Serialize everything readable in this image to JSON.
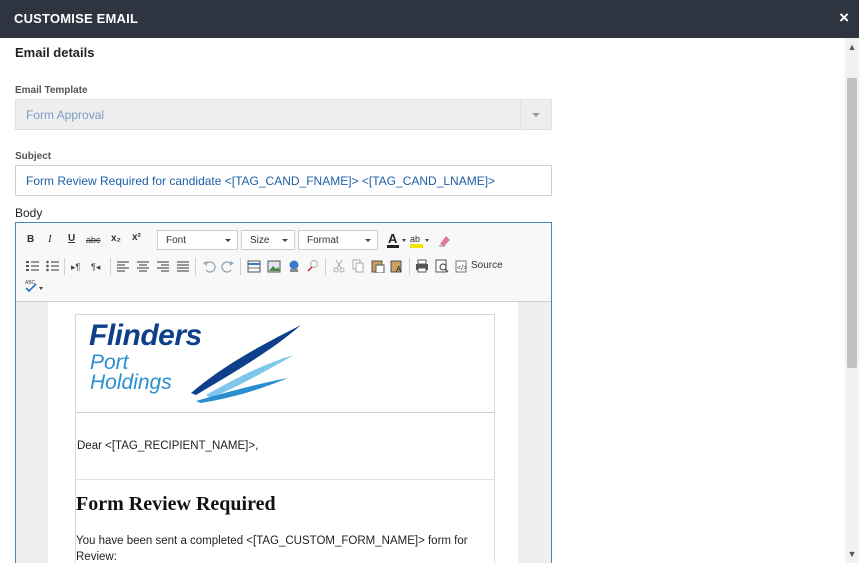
{
  "dialog": {
    "title": "CUSTOMISE EMAIL",
    "close_glyph": "×"
  },
  "form": {
    "section_title": "Email details",
    "template_label": "Email Template",
    "template_value": "Form Approval",
    "subject_label": "Subject",
    "subject_value": "Form Review Required for candidate <[TAG_CAND_FNAME]> <[TAG_CAND_LNAME]>",
    "body_label": "Body"
  },
  "toolbar": {
    "bold": "B",
    "italic": "I",
    "underline": "U",
    "strike": "abc",
    "subscript": "x₂",
    "superscript": "x²",
    "font_dropdown": "Font",
    "size_dropdown": "Size",
    "format_dropdown": "Format",
    "source_label": "Source",
    "icons": [
      "numbered-list-icon",
      "bullet-list-icon",
      "ltr-icon",
      "rtl-icon",
      "align-left-icon",
      "align-center-icon",
      "align-right-icon",
      "justify-icon",
      "undo-icon",
      "redo-icon",
      "table-icon",
      "image-icon",
      "link-icon",
      "unlink-icon",
      "cut-icon",
      "copy-icon",
      "paste-icon",
      "paste-text-icon",
      "print-icon",
      "preview-icon",
      "source-icon",
      "spellcheck-icon"
    ]
  },
  "email_body": {
    "logo_line1": "Flinders",
    "logo_line2": "Port",
    "logo_line3": "Holdings",
    "greeting": "Dear <[TAG_RECIPIENT_NAME]>,",
    "heading": "Form Review Required",
    "paragraph": "You have been sent a completed <[TAG_CUSTOM_FORM_NAME]> form for Review:"
  },
  "colors": {
    "titlebar": "#2e3440",
    "subject_text": "#1d5fa8",
    "logo_dark": "#0d3f8a",
    "logo_light": "#2a8fd0"
  }
}
